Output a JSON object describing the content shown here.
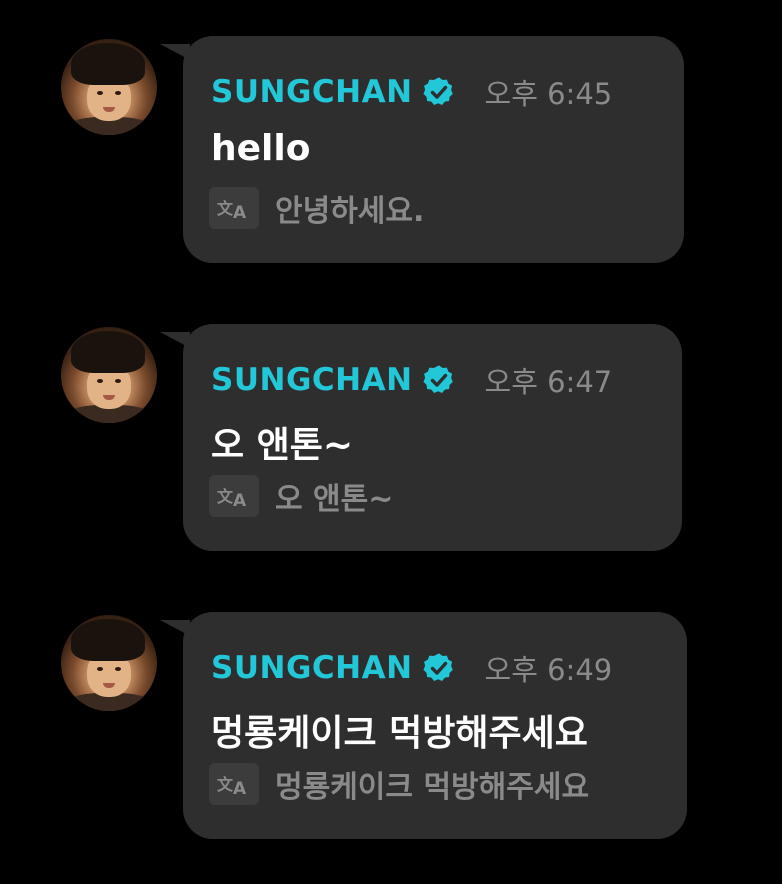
{
  "messages": [
    {
      "author": "SUNGCHAN",
      "time": "오후 6:45",
      "text": "hello",
      "translation": "안녕하세요."
    },
    {
      "author": "SUNGCHAN",
      "time": "오후 6:47",
      "text": "오 앤톤~",
      "translation": "오 앤톤~"
    },
    {
      "author": "SUNGCHAN",
      "time": "오후 6:49",
      "text": "멍룡케이크 먹방해주세요",
      "translation": "멍룡케이크 먹방해주세요"
    }
  ],
  "icons": {
    "verified": "verified-badge-icon",
    "translate": "translate-icon"
  },
  "colors": {
    "background": "#000000",
    "bubble": "#2e2e2e",
    "author": "#22c7d8",
    "message_text": "#ffffff",
    "secondary_text": "#8a8a8a"
  }
}
